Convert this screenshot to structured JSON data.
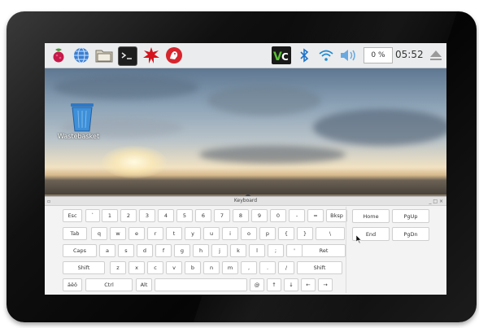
{
  "taskbar": {
    "launchers": [
      "raspberry-menu-icon",
      "browser-globe-icon",
      "file-manager-icon",
      "terminal-icon",
      "mathematica-icon",
      "wolfram-icon"
    ],
    "tray": [
      "vnc-icon",
      "bluetooth-icon",
      "wifi-icon",
      "volume-icon"
    ],
    "cpu_usage": "0 %",
    "clock": "05:52"
  },
  "desktop": {
    "trash_label": "Wastebasket"
  },
  "keyboard": {
    "title": "Keyboard",
    "window_controls": "_ □ ×",
    "rows": [
      [
        "Esc",
        "`",
        "1",
        "2",
        "3",
        "4",
        "5",
        "6",
        "7",
        "8",
        "9",
        "0",
        "-",
        "=",
        "Bksp"
      ],
      [
        "Tab",
        "q",
        "w",
        "e",
        "r",
        "t",
        "y",
        "u",
        "i",
        "o",
        "p",
        "{",
        "}",
        "\\"
      ],
      [
        "Caps",
        "a",
        "s",
        "d",
        "f",
        "g",
        "h",
        "j",
        "k",
        "l",
        ";",
        "'",
        "Ret"
      ],
      [
        "Shift",
        "z",
        "x",
        "c",
        "v",
        "b",
        "n",
        "m",
        ",",
        ".",
        "/",
        "Shift"
      ],
      [
        "äëö",
        "Ctrl",
        "Alt",
        "",
        "@",
        "↑",
        "↓",
        "←",
        "→"
      ]
    ],
    "nav": [
      "Home",
      "PgUp",
      "End",
      "PgDn"
    ]
  },
  "colors": {
    "taskbar_bg": "#ebeced",
    "keyboard_bg": "#f3f3f3",
    "bezel": "#111111"
  }
}
